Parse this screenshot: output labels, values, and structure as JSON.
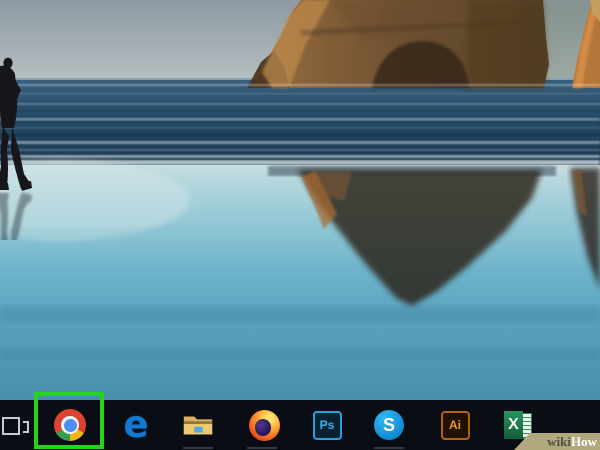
{
  "wallpaper": {
    "scene": "beach with coastal rock formations reflected on wet sand, person walking at shoreline"
  },
  "taskbar": {
    "background": "#0a0e14",
    "items": [
      {
        "name": "task-view"
      },
      {
        "name": "chrome",
        "highlighted": true
      },
      {
        "name": "edge",
        "glyph": "e"
      },
      {
        "name": "file-explorer"
      },
      {
        "name": "firefox"
      },
      {
        "name": "photoshop",
        "glyph": "Ps"
      },
      {
        "name": "skype",
        "glyph": "S"
      },
      {
        "name": "illustrator",
        "glyph": "Ai"
      },
      {
        "name": "excel",
        "glyph": "X"
      }
    ]
  },
  "highlight": {
    "target": "chrome",
    "color": "#26d41c"
  },
  "watermark": {
    "wiki": "wiki",
    "how": "How"
  }
}
